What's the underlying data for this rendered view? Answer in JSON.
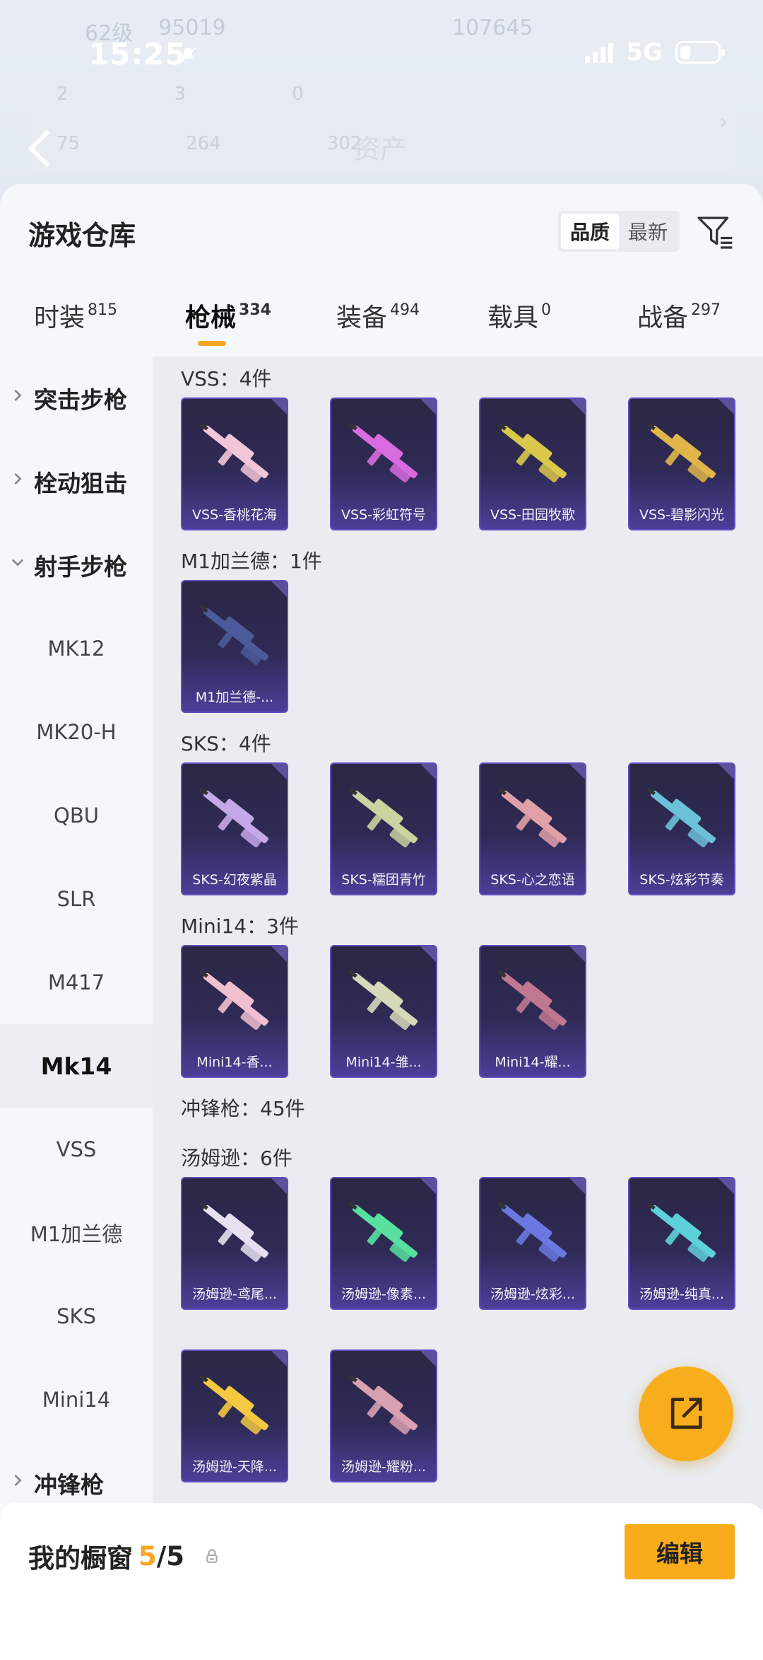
{
  "background": {
    "level": "62级",
    "coins": "95019",
    "points": "107645",
    "stats_row1": [
      "2",
      "3",
      "0"
    ],
    "stats_row2": [
      "75",
      "264",
      "302"
    ],
    "asset_label": "资产"
  },
  "status": {
    "time": "15:25",
    "network": "5G"
  },
  "header": {
    "title": "游戏仓库",
    "sort_options": [
      "品质",
      "最新"
    ],
    "active_sort": "品质"
  },
  "tabs": [
    {
      "label": "时装",
      "count": "815"
    },
    {
      "label": "枪械",
      "count": "334",
      "active": true
    },
    {
      "label": "装备",
      "count": "494"
    },
    {
      "label": "载具",
      "count": "0"
    },
    {
      "label": "战备",
      "count": "297"
    }
  ],
  "sidebar": [
    {
      "label": "突击步枪",
      "type": "category",
      "expanded": false
    },
    {
      "label": "栓动狙击",
      "type": "category",
      "expanded": false
    },
    {
      "label": "射手步枪",
      "type": "category",
      "expanded": true
    },
    {
      "label": "MK12",
      "type": "item"
    },
    {
      "label": "MK20-H",
      "type": "item"
    },
    {
      "label": "QBU",
      "type": "item"
    },
    {
      "label": "SLR",
      "type": "item"
    },
    {
      "label": "M417",
      "type": "item"
    },
    {
      "label": "Mk14",
      "type": "item",
      "active": true
    },
    {
      "label": "VSS",
      "type": "item"
    },
    {
      "label": "M1加兰德",
      "type": "item"
    },
    {
      "label": "SKS",
      "type": "item"
    },
    {
      "label": "Mini14",
      "type": "item"
    },
    {
      "label": "冲锋枪",
      "type": "category",
      "expanded": false
    }
  ],
  "groups": [
    {
      "label": "VSS：4件",
      "items": [
        {
          "name": "VSS-香桃花海",
          "color": "#f2c6d8"
        },
        {
          "name": "VSS-彩虹符号",
          "color": "#d86be0"
        },
        {
          "name": "VSS-田园牧歌",
          "color": "#d9c84a"
        },
        {
          "name": "VSS-碧影闪光",
          "color": "#e0b64a"
        }
      ]
    },
    {
      "label": "M1加兰德：1件",
      "items": [
        {
          "name": "M1加兰德-...",
          "color": "#4a5a9a"
        }
      ]
    },
    {
      "label": "SKS：4件",
      "items": [
        {
          "name": "SKS-幻夜紫晶",
          "color": "#c5a8e8"
        },
        {
          "name": "SKS-糯团青竹",
          "color": "#c9d4a0"
        },
        {
          "name": "SKS-心之恋语",
          "color": "#e0a0a8"
        },
        {
          "name": "SKS-炫彩节奏",
          "color": "#6cc0d8"
        }
      ]
    },
    {
      "label": "Mini14：3件",
      "items": [
        {
          "name": "Mini14-香...",
          "color": "#f0c0d0"
        },
        {
          "name": "Mini14-雏...",
          "color": "#d6d9b8"
        },
        {
          "name": "Mini14-耀...",
          "color": "#c07890"
        }
      ]
    },
    {
      "label": "冲锋枪：45件",
      "items": []
    },
    {
      "label": "汤姆逊：6件",
      "items": [
        {
          "name": "汤姆逊-鸢尾...",
          "color": "#e6e0f0"
        },
        {
          "name": "汤姆逊-像素...",
          "color": "#58e0a0"
        },
        {
          "name": "汤姆逊-炫彩...",
          "color": "#6a78e0"
        },
        {
          "name": "汤姆逊-纯真...",
          "color": "#5ed0d8"
        },
        {
          "name": "汤姆逊-天降...",
          "color": "#f5c842"
        },
        {
          "name": "汤姆逊-耀粉...",
          "color": "#d8a0b0"
        }
      ]
    }
  ],
  "bottom": {
    "showcase_label": "我的橱窗",
    "showcase_count": "5",
    "showcase_total": "/5",
    "edit_label": "编辑"
  },
  "colors": {
    "accent": "#f5a623",
    "card_bg": "#2e2a55",
    "card_border": "#5d4fbf"
  }
}
